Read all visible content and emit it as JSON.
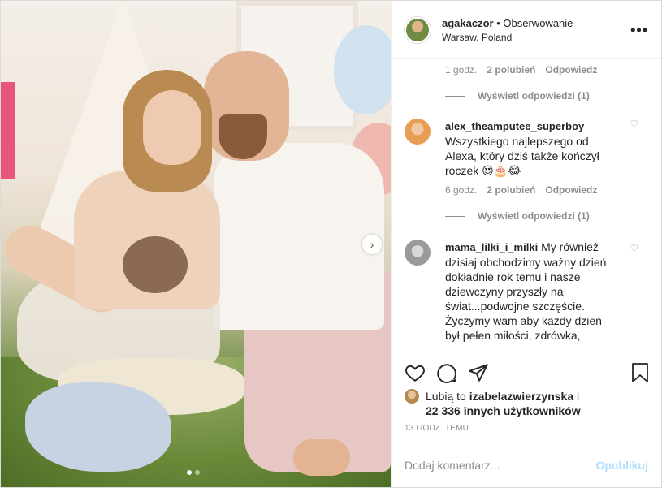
{
  "header": {
    "username": "agakaczor",
    "separator": "•",
    "follow_label": "Obserwowanie",
    "location": "Warsaw, Poland",
    "more_label": "•••"
  },
  "comments": [
    {
      "username": "",
      "text": "",
      "time": "1 godz.",
      "likes": "2 polubień",
      "reply": "Odpowiedz",
      "view_replies": "Wyświetl odpowiedzi (1)"
    },
    {
      "username": "alex_theamputee_superboy",
      "text": "Wszystkiego najlepszego od Alexa, który dziś także kończył roczek 😍🎂😂",
      "time": "6 godz.",
      "likes": "2 polubień",
      "reply": "Odpowiedz",
      "view_replies": "Wyświetl odpowiedzi (1)"
    },
    {
      "username": "mama_lilki_i_milki",
      "text": "My również dzisiaj obchodzimy ważny dzień dokładnie rok temu i nasze dziewczyny przyszły na świat...podwojne szczęście. Życzymy wam aby każdy dzień był pełen miłości, zdrówka,"
    }
  ],
  "likes": {
    "prefix": "Lubią to",
    "user": "izabelazwierzynska",
    "conj": "i",
    "others": "22 336 innych użytkowników"
  },
  "timestamp": "13 GODZ. TEMU",
  "add_comment": {
    "placeholder": "Dodaj komentarz...",
    "publish_label": "Opublikuj"
  },
  "carousel": {
    "next_label": "›",
    "slides": 2,
    "active_slide": 1
  },
  "icons": {
    "heart": "heart-icon",
    "comment": "comment-icon",
    "share": "share-icon",
    "save": "bookmark-icon"
  },
  "colors": {
    "link": "#b2dffc",
    "muted": "#8e8e8e",
    "text": "#262626"
  }
}
